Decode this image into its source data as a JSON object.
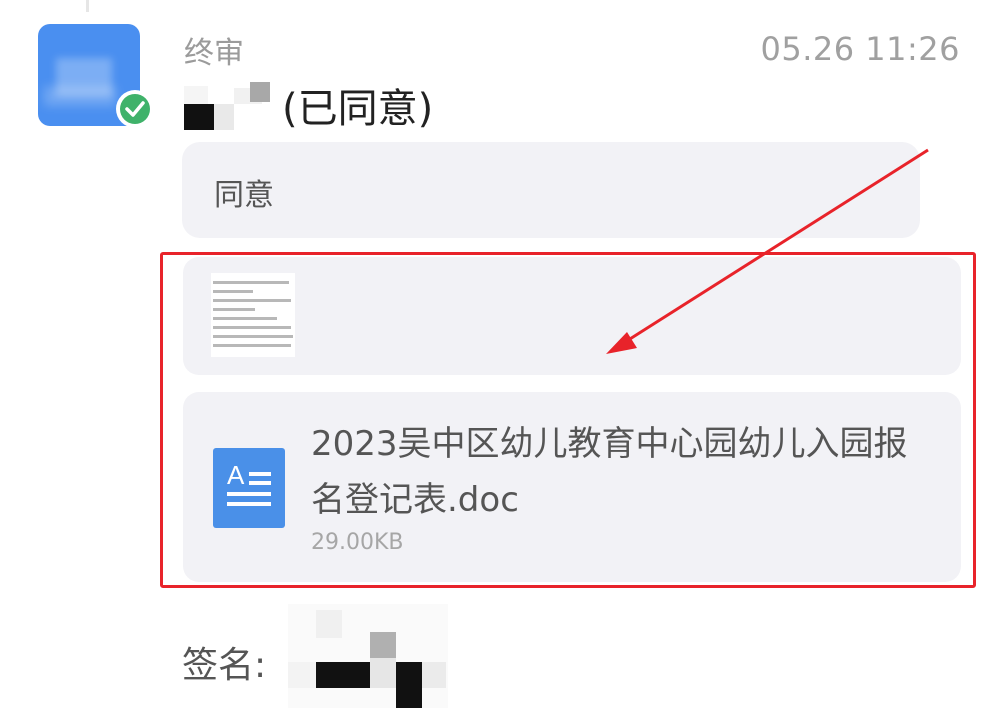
{
  "approval": {
    "step_label": "终审",
    "timestamp": "05.26 11:26",
    "status_text": "(已同意)",
    "comment": "同意",
    "signature_label": "签名:"
  },
  "attachment": {
    "file_name": "2023吴中区幼儿教育中心园幼儿入园报名登记表.doc",
    "file_size": "29.00KB",
    "icon": "word-document-icon"
  },
  "colors": {
    "accent_blue": "#4a8ff0",
    "approved_green": "#3fb26a",
    "highlight_red": "#e8232a",
    "card_background": "#f2f2f6"
  }
}
